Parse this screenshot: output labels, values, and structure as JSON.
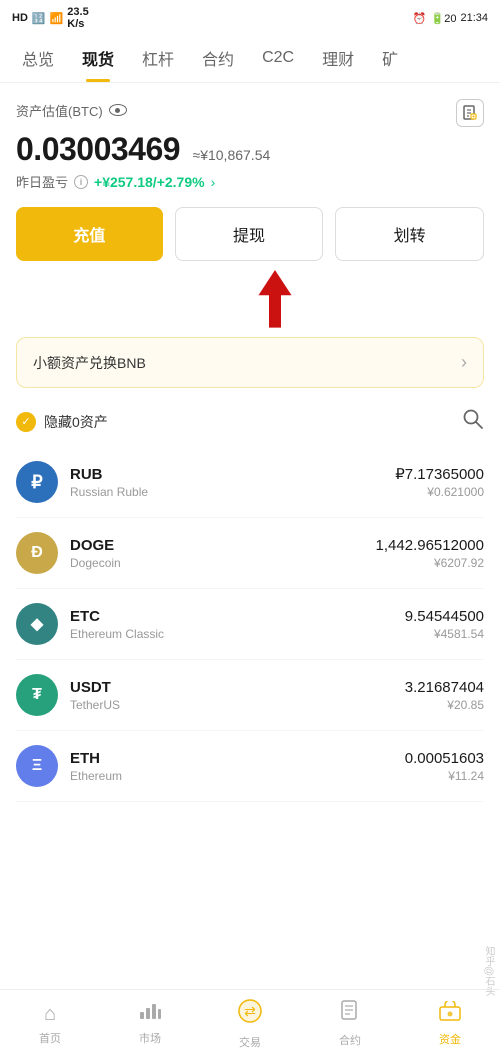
{
  "statusBar": {
    "left": "HD 26 46",
    "speed": "23.5 K/s",
    "time": "21:34",
    "battery": "20"
  },
  "navTabs": [
    {
      "id": "overview",
      "label": "总览",
      "active": false
    },
    {
      "id": "spot",
      "label": "现货",
      "active": true
    },
    {
      "id": "leverage",
      "label": "杠杆",
      "active": false
    },
    {
      "id": "contract",
      "label": "合约",
      "active": false
    },
    {
      "id": "c2c",
      "label": "C2C",
      "active": false
    },
    {
      "id": "finance",
      "label": "理财",
      "active": false
    },
    {
      "id": "mining",
      "label": "矿",
      "active": false
    }
  ],
  "assetSection": {
    "label": "资产估值(BTC)",
    "btcValue": "0.03003469",
    "cnyApprox": "≈¥10,867.54",
    "profitLabel": "昨日盈亏",
    "profitValue": "+¥257.18/+2.79%"
  },
  "buttons": {
    "deposit": "充值",
    "withdraw": "提现",
    "transfer": "划转"
  },
  "bnbBanner": {
    "text": "小额资产兑换BNB"
  },
  "filter": {
    "label": "隐藏0资产"
  },
  "assets": [
    {
      "id": "rub",
      "symbol": "RUB",
      "name": "Russian Ruble",
      "amount": "₽7.17365000",
      "cny": "¥0.621000",
      "iconColor": "rub",
      "iconText": "₽"
    },
    {
      "id": "doge",
      "symbol": "DOGE",
      "name": "Dogecoin",
      "amount": "1,442.96512000",
      "cny": "¥6207.92",
      "iconColor": "doge",
      "iconText": "Ð"
    },
    {
      "id": "etc",
      "symbol": "ETC",
      "name": "Ethereum Classic",
      "amount": "9.54544500",
      "cny": "¥4581.54",
      "iconColor": "etc",
      "iconText": "◆"
    },
    {
      "id": "usdt",
      "symbol": "USDT",
      "name": "TetherUS",
      "amount": "3.21687404",
      "cny": "¥20.85",
      "iconColor": "usdt",
      "iconText": "₮"
    },
    {
      "id": "eth",
      "symbol": "ETH",
      "name": "Ethereum",
      "amount": "0.00051603",
      "cny": "¥11.24",
      "iconColor": "eth",
      "iconText": "Ξ"
    }
  ],
  "bottomNav": [
    {
      "id": "home",
      "label": "首页",
      "active": false,
      "icon": "⌂"
    },
    {
      "id": "market",
      "label": "市场",
      "active": false,
      "icon": "📊"
    },
    {
      "id": "trade",
      "label": "交易",
      "active": false,
      "icon": "⇄"
    },
    {
      "id": "contracts",
      "label": "合约",
      "active": false,
      "icon": "📋"
    },
    {
      "id": "assets",
      "label": "资金",
      "active": true,
      "icon": "💼"
    }
  ]
}
